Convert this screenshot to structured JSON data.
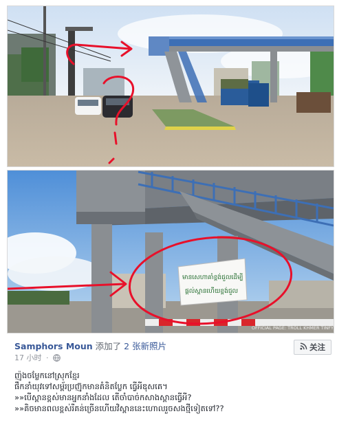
{
  "post": {
    "author": "Samphors Moun",
    "action": "添加了",
    "photo_count_label": "2 张新照片",
    "time": "17 小时",
    "separator": "·",
    "follow_label": "关注",
    "lines": [
      "ញ៉ុងចម្លែកនៅស្រុកខ្មែរ",
      "ផឹកនាំយុវទៅសម្ព័រប្រញ៊ុកមានគំនិតប្លែក ធ្វើអីឌុសគេ។",
      "»»បើស្ពានខ្ពស់មានអ្នកនាំងដែល តើចាំបាច់កសាងស្ពានធ្វើអី?",
      "»»គិចមានពលខ្ពស់រីគន់ច្រើនហើយវិស្ពាននេះហោលរួចសងថ្មីទៀតទៅ??"
    ]
  },
  "photos": {
    "banner_text": [
      "មានសេហាគាំខ្ពង់ជួលដើម្បី",
      "ផ្តល់ស្ពានហើយខ្ពង់ជួល"
    ],
    "watermark": "OFFICIAL PAGE: TROLL KHMER TINFY"
  },
  "colors": {
    "link": "#385898",
    "meta": "#90949c",
    "annotation_red": "#e8102a",
    "bridge_blue": "#3d6fb5"
  }
}
